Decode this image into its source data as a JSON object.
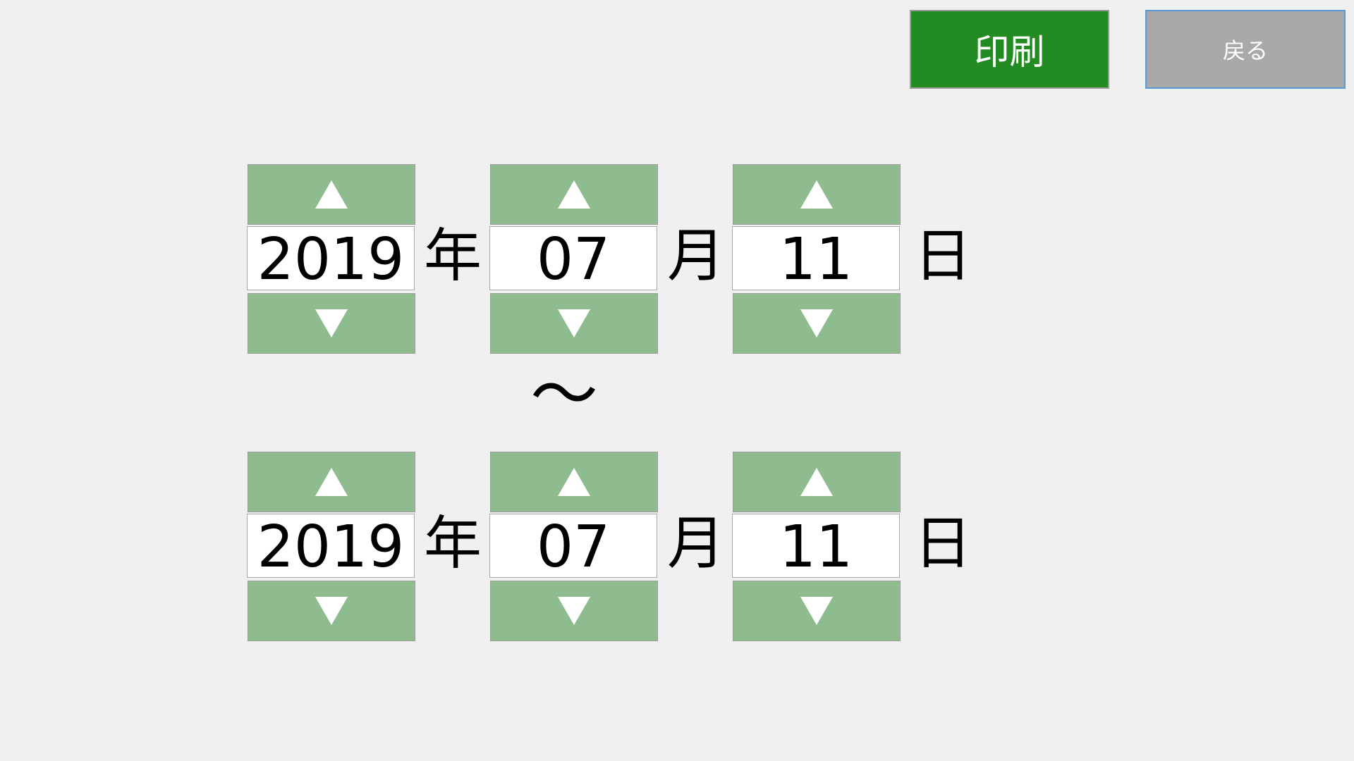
{
  "buttons": {
    "print_label": "印刷",
    "back_label": "戻る"
  },
  "from": {
    "year": "2019",
    "month": "07",
    "day": "11"
  },
  "to": {
    "year": "2019",
    "month": "07",
    "day": "11"
  },
  "units": {
    "year": "年",
    "month": "月",
    "day": "日"
  },
  "separator": "～",
  "colors": {
    "print_button": "#228b22",
    "back_button": "#a9a9a9",
    "spinner_arrow": "#8fbc8f",
    "background": "#f0f0f0"
  },
  "icons": {
    "increment": "triangle-up-icon",
    "decrement": "triangle-down-icon"
  }
}
